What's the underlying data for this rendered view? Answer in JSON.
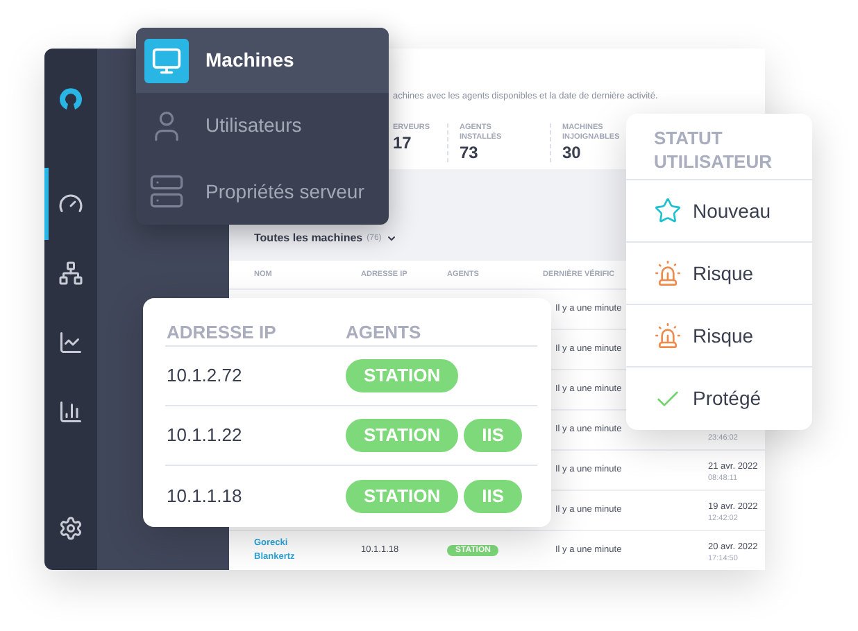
{
  "sidebar": {
    "items": [
      {
        "kind": "logo",
        "selected": false
      },
      {
        "kind": "gauge",
        "selected": true
      },
      {
        "kind": "network",
        "selected": false
      },
      {
        "kind": "line-chart",
        "selected": false
      },
      {
        "kind": "bar-chart",
        "selected": false
      },
      {
        "kind": "settings",
        "selected": false
      }
    ]
  },
  "menu": {
    "items": [
      {
        "label": "Machines",
        "kind": "monitor",
        "selected": true
      },
      {
        "label": "Utilisateurs",
        "kind": "user",
        "selected": false
      },
      {
        "label": "Propriétés serveur",
        "kind": "server",
        "selected": false
      }
    ]
  },
  "page": {
    "description": "achines avec les agents disponibles et la date de dernière activité.",
    "stats": [
      {
        "label": "ERVEURS",
        "value": "17"
      },
      {
        "label": "AGENTS INSTALLÉS",
        "value": "73"
      },
      {
        "label": "MACHINES INJOIGNABLES",
        "value": "30"
      }
    ],
    "filter": {
      "label": "Toutes les machines",
      "count": "(76)"
    },
    "table": {
      "columns": [
        "NOM",
        "ADRESSE IP",
        "AGENTS",
        "DERNIÈRE VÉRIFIC"
      ],
      "rows": [
        {
          "last_check": "Il y a une minute"
        },
        {
          "last_check": "Il y a une minute"
        },
        {
          "last_check": "Il y a une minute"
        },
        {
          "last_check": "Il y a une minute",
          "time": "23:46:02"
        },
        {
          "last_check": "Il y a une minute",
          "date": "21 avr. 2022",
          "time": "08:48:11"
        },
        {
          "last_check": "Il y a une minute",
          "date": "19 avr. 2022",
          "time": "12:42:02"
        },
        {
          "name": "Gorecki Blankertz",
          "ip": "10.1.1.18",
          "agent": "STATION",
          "last_check": "Il y a une minute",
          "date": "20 avr. 2022",
          "time": "17:14:50"
        }
      ]
    }
  },
  "ip_popup": {
    "columns": [
      "ADRESSE IP",
      "AGENTS"
    ],
    "rows": [
      {
        "ip": "10.1.2.72",
        "agents": [
          "STATION"
        ]
      },
      {
        "ip": "10.1.1.22",
        "agents": [
          "STATION",
          "IIS"
        ]
      },
      {
        "ip": "10.1.1.18",
        "agents": [
          "STATION",
          "IIS"
        ]
      }
    ]
  },
  "status_popup": {
    "title": "STATUT UTILISATEUR",
    "items": [
      {
        "label": "Nouveau",
        "kind": "new"
      },
      {
        "label": "Risque",
        "kind": "risk"
      },
      {
        "label": "Risque",
        "kind": "risk"
      },
      {
        "label": "Protégé",
        "kind": "protected"
      }
    ]
  }
}
